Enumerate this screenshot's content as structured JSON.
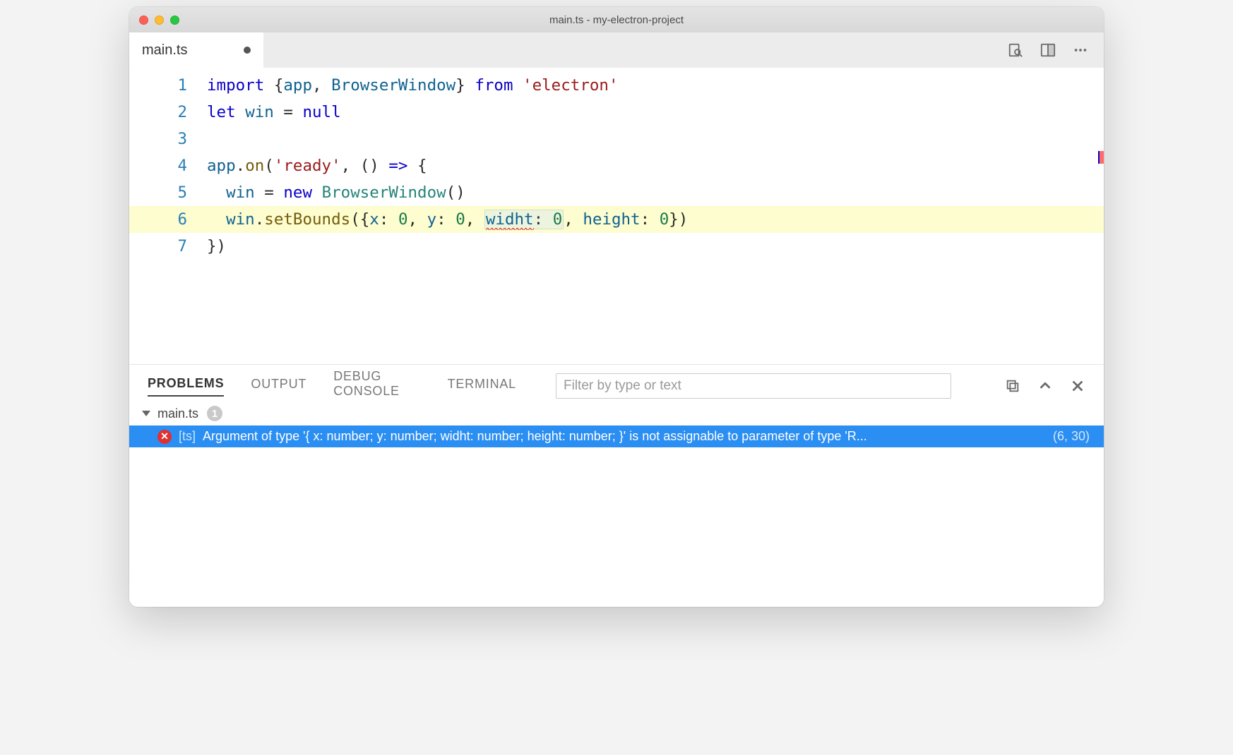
{
  "window": {
    "title": "main.ts - my-electron-project"
  },
  "tabs": {
    "active": {
      "label": "main.ts",
      "dirty": true
    }
  },
  "toolbar_icons": {
    "find_in_file": "find-in-file-icon",
    "split_editor": "split-editor-icon",
    "more": "more-icon"
  },
  "editor": {
    "line_numbers": [
      "1",
      "2",
      "3",
      "4",
      "5",
      "6",
      "7"
    ],
    "line1": {
      "kw_import": "import",
      "brace_open": " {",
      "ident_app": "app",
      "comma": ", ",
      "ident_bw": "BrowserWindow",
      "brace_close": "} ",
      "kw_from": "from",
      "str": " 'electron'"
    },
    "line2": {
      "kw_let": "let",
      "sp1": " ",
      "ident_win": "win",
      "eq": " = ",
      "kw_null": "null"
    },
    "line3": {
      "blank": ""
    },
    "line4": {
      "ident_app": "app",
      "dot": ".",
      "fn_on": "on",
      "paren_open": "(",
      "str_ready": "'ready'",
      "comma": ", () ",
      "arrow": "=>",
      "rest": " {"
    },
    "line5": {
      "indent": "  ",
      "ident_win": "win",
      "eq": " = ",
      "kw_new": "new",
      "sp": " ",
      "type_bw": "BrowserWindow",
      "parens": "()"
    },
    "line6": {
      "indent": "  ",
      "ident_win": "win",
      "dot": ".",
      "fn_setBounds": "setBounds",
      "open": "({",
      "k_x": "x",
      "c1": ": ",
      "v_x": "0",
      "s1": ", ",
      "k_y": "y",
      "c2": ": ",
      "v_y": "0",
      "s2": ", ",
      "k_widht": "widht",
      "c3": ": ",
      "v_widht": "0",
      "s3": ", ",
      "k_height": "height",
      "c4": ": ",
      "v_height": "0",
      "close": "})"
    },
    "line7": {
      "text": "})"
    }
  },
  "panel": {
    "tabs": {
      "problems": "PROBLEMS",
      "output": "OUTPUT",
      "debug": "DEBUG CONSOLE",
      "terminal": "TERMINAL"
    },
    "filter_placeholder": "Filter by type or text",
    "file": {
      "name": "main.ts",
      "count": "1"
    },
    "problem": {
      "source": "[ts]",
      "message": "Argument of type '{ x: number; y: number; widht: number; height: number; }' is not assignable to parameter of type 'R...",
      "location": "(6, 30)"
    }
  }
}
